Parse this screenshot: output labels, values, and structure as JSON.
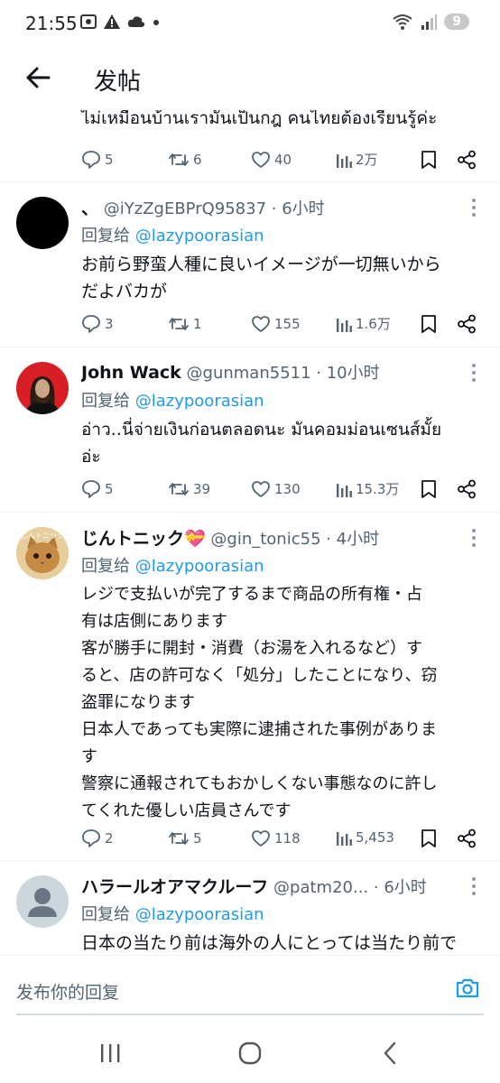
{
  "status_bar": {
    "time": "21:55",
    "battery": "9"
  },
  "header": {
    "title": "发帖"
  },
  "tweets": [
    {
      "text": "ไม่เหมือนบ้านเรามันเป็นกฎ คนไทยต้องเรียนรู้ค่ะ",
      "replies": "5",
      "retweets": "6",
      "likes": "40",
      "views": "2万"
    },
    {
      "name": "、",
      "handle": "@iYzZgEBPrQ95837 · 6小时",
      "reply_prefix": "回复给",
      "reply_to": "@lazypoorasian",
      "text": "お前ら野蛮人種に良いイメージが一切無いから\nだよバカが",
      "replies": "3",
      "retweets": "1",
      "likes": "155",
      "views": "1.6万"
    },
    {
      "name": "John Wack",
      "handle": "@gunman5511 · 10小时",
      "reply_prefix": "回复给",
      "reply_to": "@lazypoorasian",
      "text": "อ่าว..นี่จ่ายเงินก่อนตลอดนะ มันคอมม่อนเซนส์มั้ย\nอ่ะ",
      "replies": "5",
      "retweets": "39",
      "likes": "130",
      "views": "15.3万"
    },
    {
      "name": "じんトニック💝",
      "handle": "@gin_tonic55 · 4小时",
      "reply_prefix": "回复给",
      "reply_to": "@lazypoorasian",
      "avatar_label": "じんトニック",
      "text": "レジで支払いが完了するまで商品の所有権・占\n有は店側にあります\n客が勝手に開封・消費（お湯を入れるなど）す\nると、店の許可なく「処分」したことになり、窃\n盗罪になります\n日本人であっても実際に逮捕された事例がありま\nす\n警察に通報されてもおかしくない事態なのに許し\nてくれた優しい店員さんです",
      "replies": "2",
      "retweets": "5",
      "likes": "118",
      "views": "5,453"
    },
    {
      "name": "ハラールオアマクルーフ",
      "handle": "@patm20... · 6小时",
      "reply_prefix": "回复给",
      "reply_to": "@lazypoorasian",
      "text": "日本の当たり前は海外の人にとっては当たり前で"
    }
  ],
  "reply_bar": {
    "placeholder": "发布你的回复"
  },
  "icons": {
    "back": "arrow-left-icon",
    "reply": "speech-bubble-icon",
    "retweet": "retweet-icon",
    "like": "heart-icon",
    "views": "bar-chart-icon",
    "bookmark": "bookmark-icon",
    "share": "share-icon",
    "camera": "camera-icon",
    "nav_recents": "recents-icon",
    "nav_home": "home-circle-icon",
    "nav_back": "chevron-left-icon"
  },
  "colors": {
    "accent": "#1d9bf0",
    "text": "#0f1419",
    "muted": "#536471"
  }
}
